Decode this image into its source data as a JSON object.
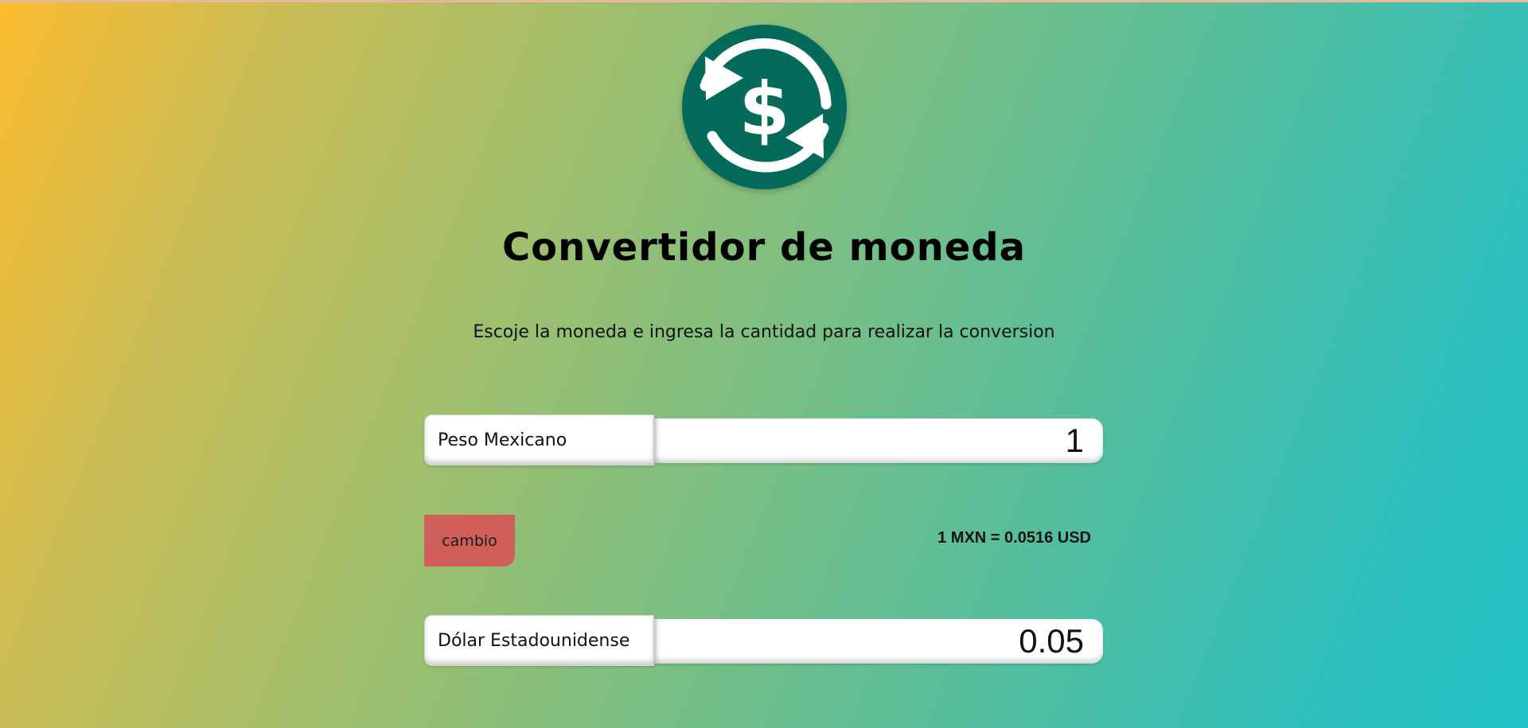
{
  "app": {
    "title": "Convertidor de moneda",
    "subtitle": "Escoje la moneda e ingresa la cantidad para realizar la conversion",
    "logo_icon": "currency-exchange-icon"
  },
  "converter": {
    "from": {
      "currency": "Peso Mexicano",
      "amount": "1"
    },
    "swap_label": "cambio",
    "rate_text": "1 MXN = 0.0516 USD",
    "to": {
      "currency": "Dólar Estadounidense",
      "amount": "0.05"
    }
  },
  "colors": {
    "logo_background": "#046a59",
    "swap_button": "#cf5f58",
    "gradient_start": "#fbbc2f",
    "gradient_end": "#22c2c6"
  }
}
